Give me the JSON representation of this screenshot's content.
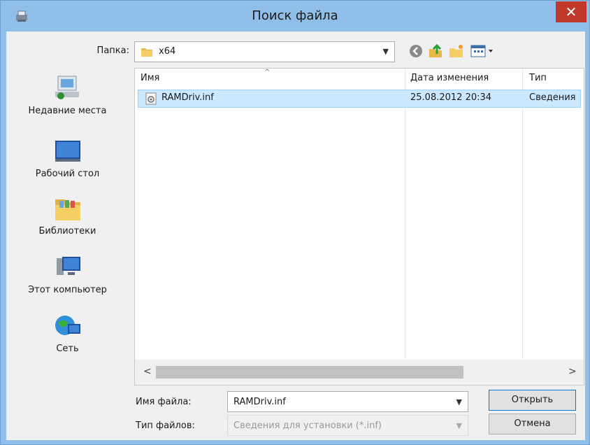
{
  "window": {
    "title": "Поиск файла",
    "close_glyph": "✕"
  },
  "toolbar": {
    "folder_label": "Папка:",
    "folder_value": "x64",
    "icons": [
      "back-icon",
      "up-folder-icon",
      "new-folder-icon",
      "view-menu-icon"
    ]
  },
  "places": [
    {
      "label": "Недавние места",
      "icon": "recent-places-icon"
    },
    {
      "label": "Рабочий стол",
      "icon": "desktop-icon"
    },
    {
      "label": "Библиотеки",
      "icon": "libraries-icon"
    },
    {
      "label": "Этот компьютер",
      "icon": "computer-icon"
    },
    {
      "label": "Сеть",
      "icon": "network-icon"
    }
  ],
  "filelist": {
    "columns": [
      "Имя",
      "Дата изменения",
      "Тип"
    ],
    "rows": [
      {
        "name": "RAMDriv.inf",
        "modified": "25.08.2012 20:34",
        "type": "Сведения"
      }
    ]
  },
  "form": {
    "filename_label": "Имя файла:",
    "filename_value": "RAMDriv.inf",
    "filetype_label": "Тип файлов:",
    "filetype_value": "Сведения для установки (*.inf)"
  },
  "buttons": {
    "open": "Открыть",
    "cancel": "Отмена"
  },
  "colors": {
    "title_bar": "#8fbfe8",
    "close": "#c0392b",
    "selection": "#cce8ff"
  }
}
